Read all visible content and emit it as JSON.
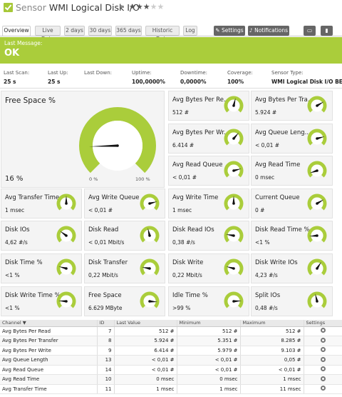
{
  "header": {
    "prefix": "Sensor",
    "name": "WMI Logical Disk I/O",
    "flag_icon": "flag-icon",
    "stars_on": "★★★",
    "stars_off": "★★"
  },
  "tabs": [
    "Overview",
    "Live Data",
    "2 days",
    "30 days",
    "365 days",
    "Historic Data",
    "Log"
  ],
  "buttons": {
    "settings": "Settings",
    "notifications": "Notifications"
  },
  "banner": {
    "label": "Last Message:",
    "value": "OK"
  },
  "stats": [
    {
      "label": "Last Scan:",
      "value": "25 s"
    },
    {
      "label": "Last Up:",
      "value": "25 s"
    },
    {
      "label": "Last Down:",
      "value": ""
    },
    {
      "label": "Uptime:",
      "value": "100,0000%"
    },
    {
      "label": "Downtime:",
      "value": "0,0000%"
    },
    {
      "label": "Coverage:",
      "value": "100%"
    },
    {
      "label": "Sensor Type:",
      "value": "WMI Logical Disk I/O BETA"
    }
  ],
  "big_gauge": {
    "name": "Free Space %",
    "value": "16 %",
    "min": "0 %",
    "max": "100 %",
    "level": 0.16
  },
  "tiles": [
    {
      "name": "Avg Bytes Per Re...",
      "value": "512 #",
      "level": 0.55
    },
    {
      "name": "Avg Bytes Per Tra...",
      "value": "5.924 #",
      "level": 0.72
    },
    {
      "name": "Avg Bytes Per Wr...",
      "value": "6.414 #",
      "level": 0.65
    },
    {
      "name": "Avg Queue Leng...",
      "value": "< 0,01 #",
      "level": 0.78
    },
    {
      "name": "Avg Read Queue",
      "value": "< 0,01 #",
      "level": 0.78
    },
    {
      "name": "Avg Read Time",
      "value": "0 msec",
      "level": 0.1
    },
    {
      "name": "Avg Transfer Time",
      "value": "1 msec",
      "level": 0.5
    },
    {
      "name": "Avg Write Queue",
      "value": "< 0,01 #",
      "level": 0.78
    },
    {
      "name": "Avg Write Time",
      "value": "1 msec",
      "level": 0.5
    },
    {
      "name": "Current Queue",
      "value": "0 #",
      "level": 0.72
    },
    {
      "name": "Disk IOs",
      "value": "4,62 #/s",
      "level": 0.3
    },
    {
      "name": "Disk Read",
      "value": "< 0,01 Mbit/s",
      "level": 0.45
    },
    {
      "name": "Disk Read IOs",
      "value": "0,38 #/s",
      "level": 0.2
    },
    {
      "name": "Disk Read Time %",
      "value": "<1 %",
      "level": 0.15
    },
    {
      "name": "Disk Time %",
      "value": "<1 %",
      "level": 0.22
    },
    {
      "name": "Disk Transfer",
      "value": "0,22 Mbit/s",
      "level": 0.2
    },
    {
      "name": "Disk Write",
      "value": "0,22 Mbit/s",
      "level": 0.22
    },
    {
      "name": "Disk Write IOs",
      "value": "4,23 #/s",
      "level": 0.62
    },
    {
      "name": "Disk Write Time %",
      "value": "<1 %",
      "level": 0.18
    },
    {
      "name": "Free Space",
      "value": "6.629 MByte",
      "level": 0.85
    },
    {
      "name": "Idle Time %",
      "value": ">99 %",
      "level": 0.82
    },
    {
      "name": "Split IOs",
      "value": "0,48 #/s",
      "level": 0.45
    }
  ],
  "table": {
    "headers": [
      "Channel ▼",
      "ID",
      "Last Value",
      "Minimum",
      "Maximum",
      "Settings"
    ],
    "rows": [
      [
        "Avg Bytes Per Read",
        "7",
        "512 #",
        "512 #",
        "512 #"
      ],
      [
        "Avg Bytes Per Transfer",
        "8",
        "5.924 #",
        "5.351 #",
        "8.285 #"
      ],
      [
        "Avg Bytes Per Write",
        "9",
        "6.414 #",
        "5.979 #",
        "9.103 #"
      ],
      [
        "Avg Queue Length",
        "13",
        "< 0,01 #",
        "< 0,01 #",
        "0,05 #"
      ],
      [
        "Avg Read Queue",
        "14",
        "< 0,01 #",
        "< 0,01 #",
        "< 0,01 #"
      ],
      [
        "Avg Read Time",
        "10",
        "0 msec",
        "0 msec",
        "1 msec"
      ],
      [
        "Avg Transfer Time",
        "11",
        "1 msec",
        "1 msec",
        "11 msec"
      ]
    ]
  },
  "colors": {
    "accent": "#aacd3b",
    "needle": "#111111",
    "gauge_bg": "#ffffff"
  }
}
